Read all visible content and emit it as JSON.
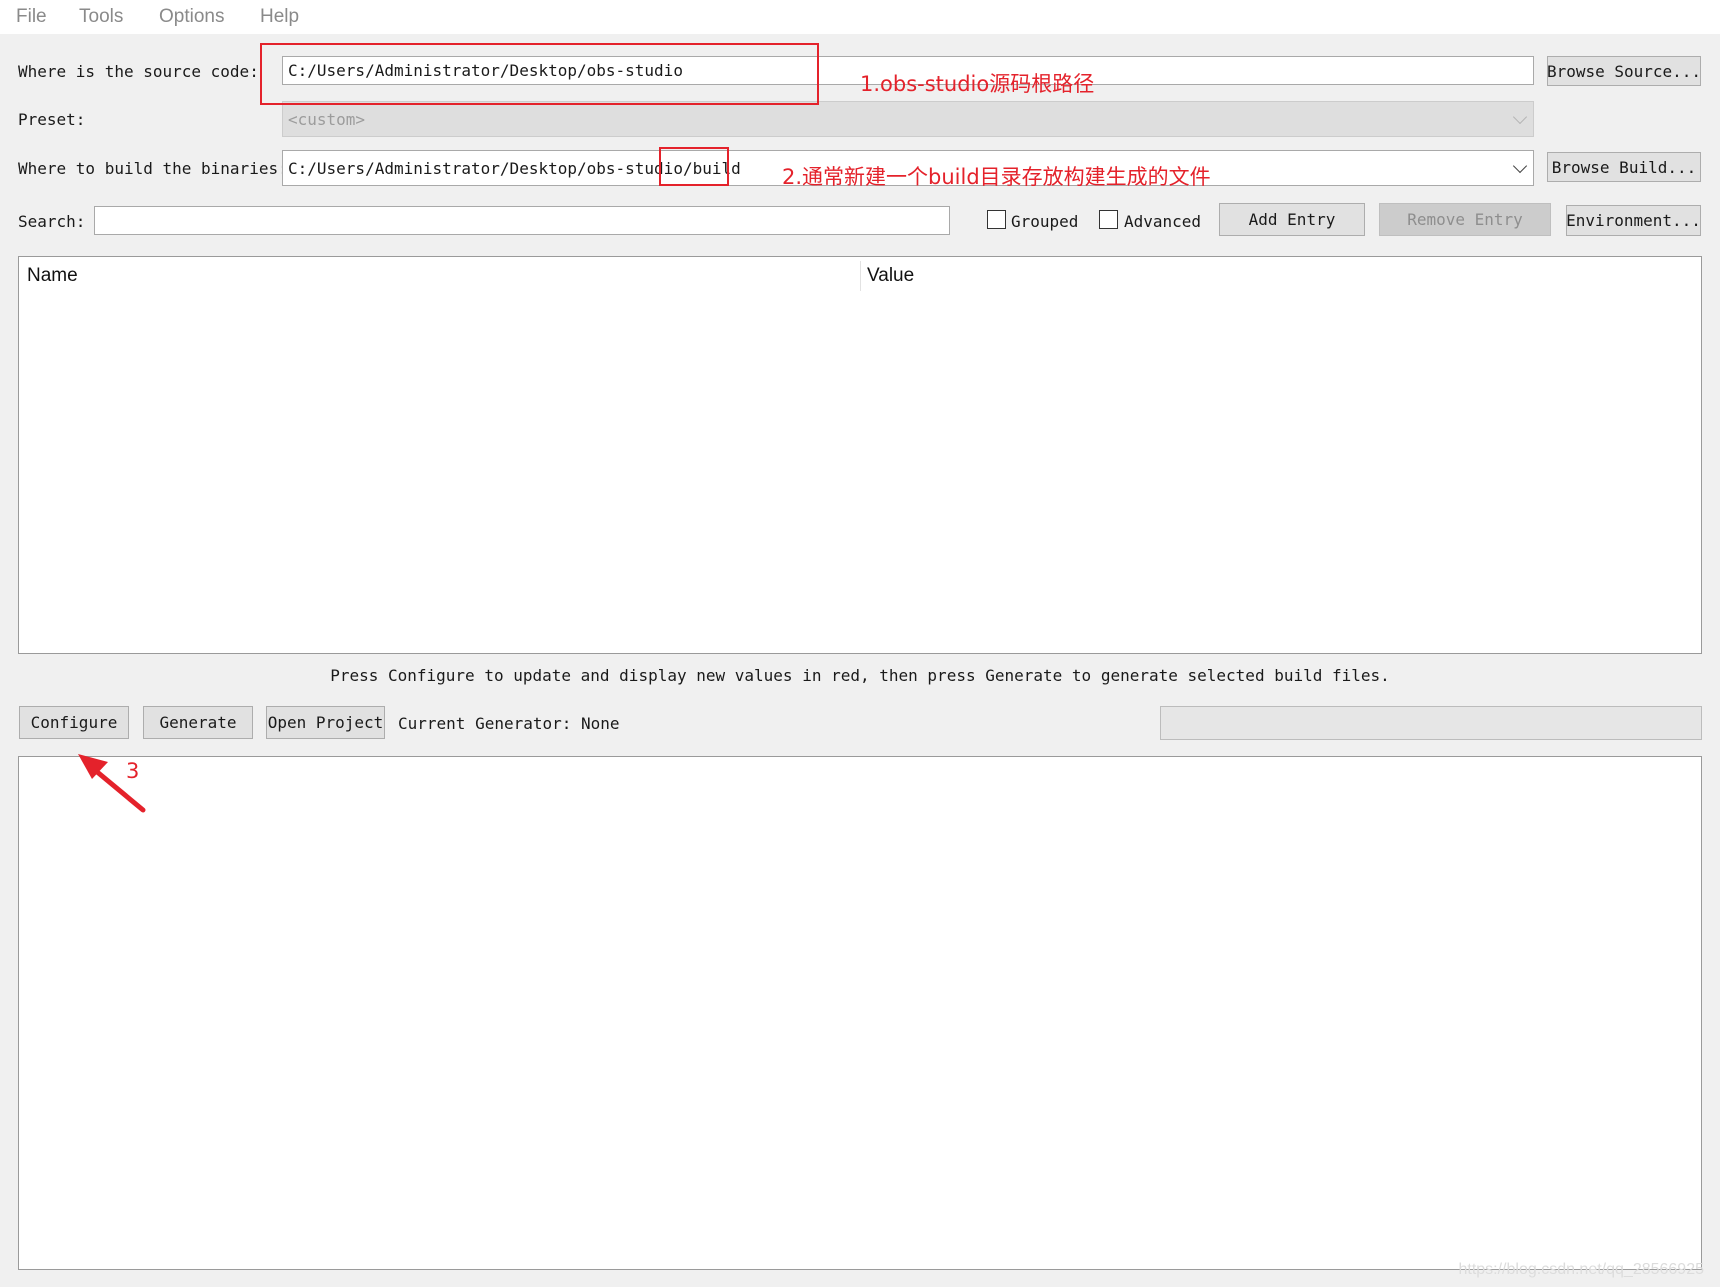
{
  "menu": [
    "File",
    "Tools",
    "Options",
    "Help"
  ],
  "source": {
    "label": "Where is the source code:",
    "value": "C:/Users/Administrator/Desktop/obs-studio",
    "browse": "Browse Source..."
  },
  "preset": {
    "label": "Preset:",
    "value": "<custom>"
  },
  "build": {
    "label": "Where to build the binaries:",
    "value": "C:/Users/Administrator/Desktop/obs-studio/build",
    "browse": "Browse Build..."
  },
  "search": {
    "label": "Search:",
    "value": "",
    "grouped": "Grouped",
    "grouped_checked": false,
    "advanced": "Advanced",
    "advanced_checked": false,
    "add_entry": "Add Entry",
    "remove_entry": "Remove Entry",
    "environment": "Environment..."
  },
  "table": {
    "columns": [
      "Name",
      "Value"
    ],
    "rows": []
  },
  "hint": "Press Configure to update and display new values in red, then press Generate to generate selected build files.",
  "actions": {
    "configure": "Configure",
    "generate": "Generate",
    "open_project": "Open Project",
    "generator": "Current Generator: None",
    "progress": 0
  },
  "output": "",
  "annotations": {
    "note1": "1.obs-studio源码根路径",
    "note2": "2.通常新建一个build目录存放构建生成的文件",
    "note3": "3"
  },
  "watermark": "https://blog.csdn.net/qq_28566925",
  "colors": {
    "annotation": "#e4222b",
    "window_bg": "#f0f0f0",
    "button_bg": "#e1e1e1"
  }
}
